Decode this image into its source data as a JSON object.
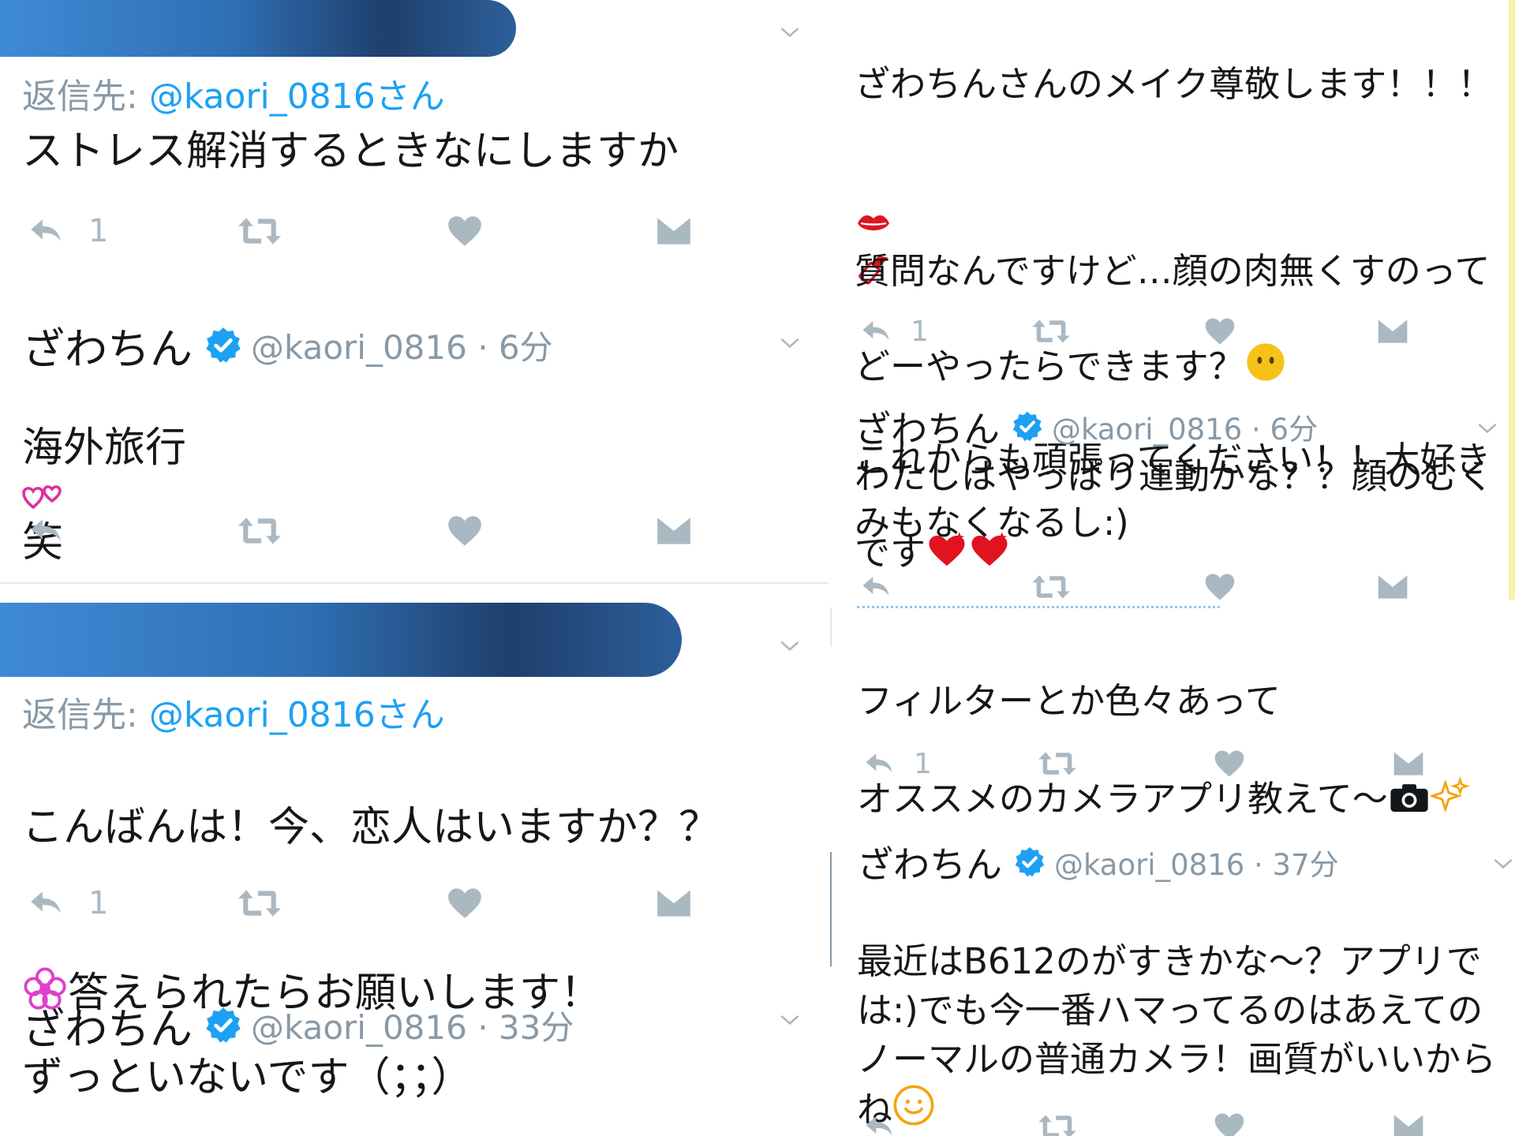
{
  "colors": {
    "accent": "#1da1f2",
    "muted": "#8899a6",
    "icon": "#aab8c2",
    "text": "#14171a"
  },
  "icons": [
    "reply-icon",
    "retweet-icon",
    "like-icon",
    "dm-icon",
    "verified-badge-icon",
    "chevron-down-icon"
  ],
  "left": {
    "q1": {
      "reply_prefix": "返信先: ",
      "reply_handle": "@kaori_0816さん",
      "text": "ストレス解消するときなにしますか",
      "reply_count": "1"
    },
    "a1": {
      "name": "ざわちん",
      "meta": "@kaori_0816 · 6分",
      "text": "海外旅行",
      "text_after": "笑"
    },
    "q2": {
      "reply_prefix": "返信先: ",
      "reply_handle": "@kaori_0816さん",
      "text_line1": "こんばんは！今、恋人はいますか？？",
      "text_line2": "答えられたらお願いします！",
      "reply_count": "1"
    },
    "a2": {
      "name": "ざわちん",
      "meta": "@kaori_0816 · 33分",
      "text": "ずっといないです（；；）"
    }
  },
  "right": {
    "q1": {
      "line1": "ざわちんさんのメイク尊敬します！！！",
      "line2": "質問なんですけど…顔の肉無くすのって",
      "line3": "どーやったらできます？",
      "line4": "これからも頑張ってください！！大好き",
      "line5": "です",
      "reply_count": "1"
    },
    "a1": {
      "name": "ざわちん",
      "meta": "@kaori_0816 · 6分",
      "text": "わたしはやっぱり運動かな？？顔のむく\nみもなくなるし:)"
    },
    "q2": {
      "line1": "フィルターとか色々あって",
      "line2": "オススメのカメラアプリ教えて〜",
      "reply_count": "1"
    },
    "a2": {
      "name": "ざわちん",
      "meta": "@kaori_0816 · 37分",
      "text": "最近はB612のがすきかな〜？アプリで\nは:)でも今一番ハマってるのはあえての\nノーマルの普通カメラ！画質がいいから\nね"
    }
  }
}
